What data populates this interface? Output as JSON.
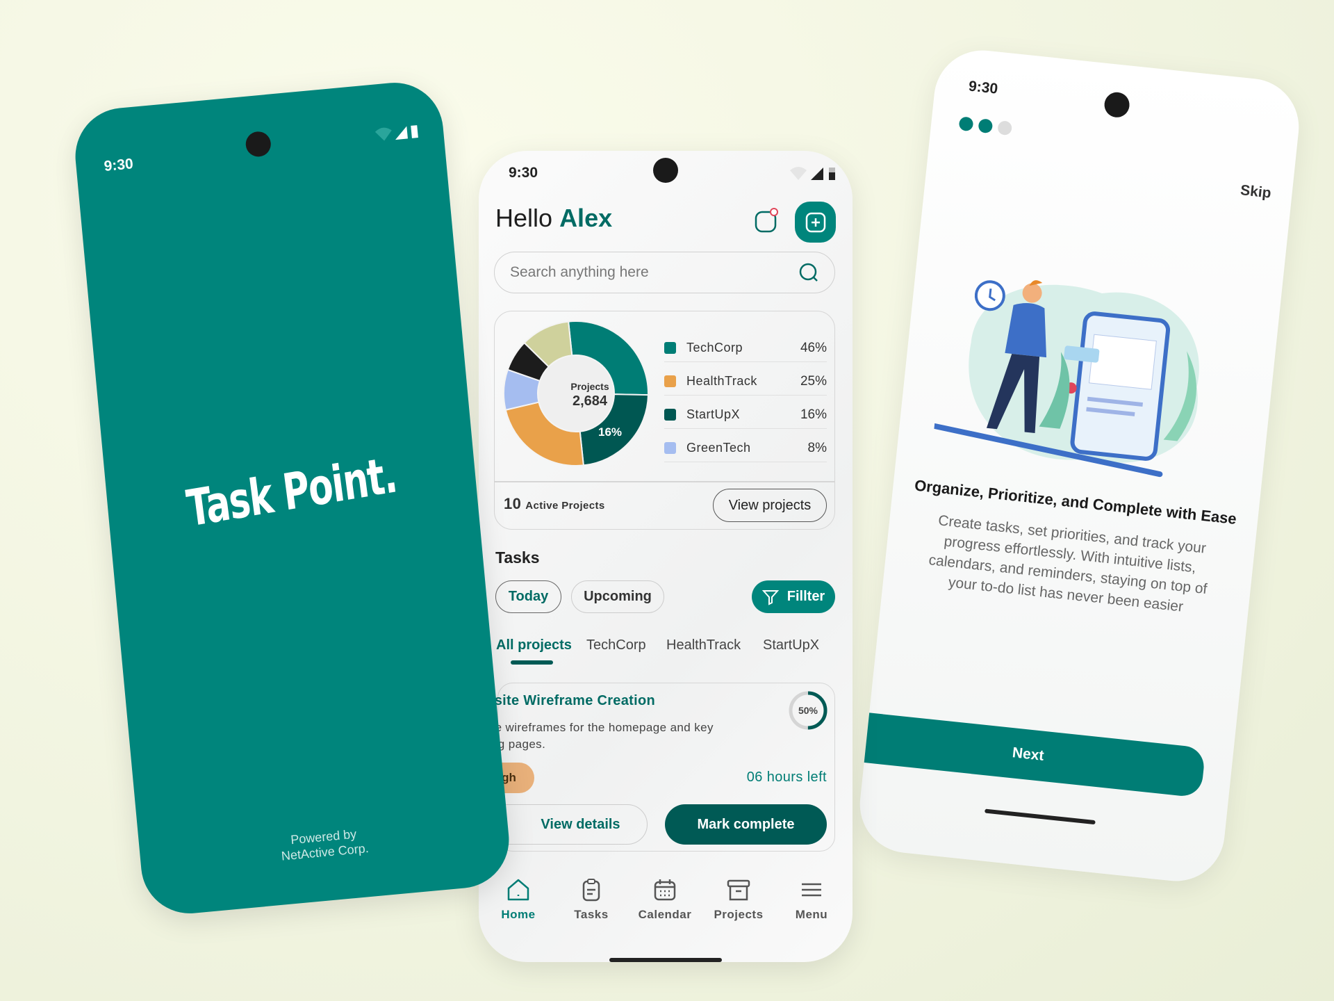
{
  "colors": {
    "brand": "#00857c",
    "brand_dark": "#005a55",
    "background": "#f1f4e0",
    "priority_high": "#e8b07a"
  },
  "splash": {
    "time": "9:30",
    "logo": "Task Point.",
    "powered_line1": "Powered by",
    "powered_line2": "NetActive Corp."
  },
  "home": {
    "time": "9:30",
    "greeting": "Hello",
    "user": "Alex",
    "icons": {
      "notification": "bell-icon",
      "add": "plus-square-icon",
      "search": "search-icon",
      "filter": "filter-icon"
    },
    "search": {
      "placeholder": "Search anything here"
    },
    "active_count": "10",
    "active_label": "Active Projects",
    "view_projects": "View projects",
    "tasks_heading": "Tasks",
    "pills": [
      "Today",
      "Upcoming"
    ],
    "filter_label": "Fillter",
    "tabs": [
      "All projects",
      "TechCorp",
      "HealthTrack",
      "StartUpX"
    ],
    "task": {
      "title": "Website Wireframe Creation",
      "description": "Create wireframes for the homepage and key landing pages.",
      "priority": "High",
      "progress_label": "50%",
      "progress": 0.5,
      "time_left": "06 hours left",
      "view_details": "View details",
      "mark_complete": "Mark complete"
    },
    "nav": [
      {
        "label": "Home",
        "icon": "home-icon"
      },
      {
        "label": "Tasks",
        "icon": "clipboard-icon"
      },
      {
        "label": "Calendar",
        "icon": "calendar-icon"
      },
      {
        "label": "Projects",
        "icon": "archive-icon"
      },
      {
        "label": "Menu",
        "icon": "menu-icon"
      }
    ]
  },
  "chart_data": {
    "type": "pie",
    "center_label": "Projects",
    "center_value": "2,684",
    "slice_label": "16%",
    "legend": [
      {
        "name": "TechCorp",
        "pct": "46%",
        "color": "#007d75"
      },
      {
        "name": "HealthTrack",
        "pct": "25%",
        "color": "#e9a14a"
      },
      {
        "name": "StartUpX",
        "pct": "16%",
        "color": "#005752"
      },
      {
        "name": "GreenTech",
        "pct": "8%",
        "color": "#a5bdf0"
      }
    ],
    "slices": [
      {
        "name": "TechCorp",
        "value": 27,
        "color": "#007d75"
      },
      {
        "name": "StartUpX",
        "value": 23,
        "color": "#005752"
      },
      {
        "name": "HealthTrack",
        "value": 23,
        "color": "#e9a14a"
      },
      {
        "name": "GreenTech",
        "value": 9,
        "color": "#a5bdf0"
      },
      {
        "name": "",
        "value": 7,
        "color": "#1c1c1c"
      },
      {
        "name": "",
        "value": 11,
        "color": "#cfd19c"
      }
    ]
  },
  "onboarding": {
    "time": "9:30",
    "skip": "Skip",
    "step": 1,
    "steps": 3,
    "heading": "Organize, Prioritize, and Complete with Ease",
    "body": "Create tasks, set priorities, and track your progress effortlessly. With intuitive lists, calendars, and reminders, staying on top of your to-do list has never been easier",
    "next": "Next"
  }
}
